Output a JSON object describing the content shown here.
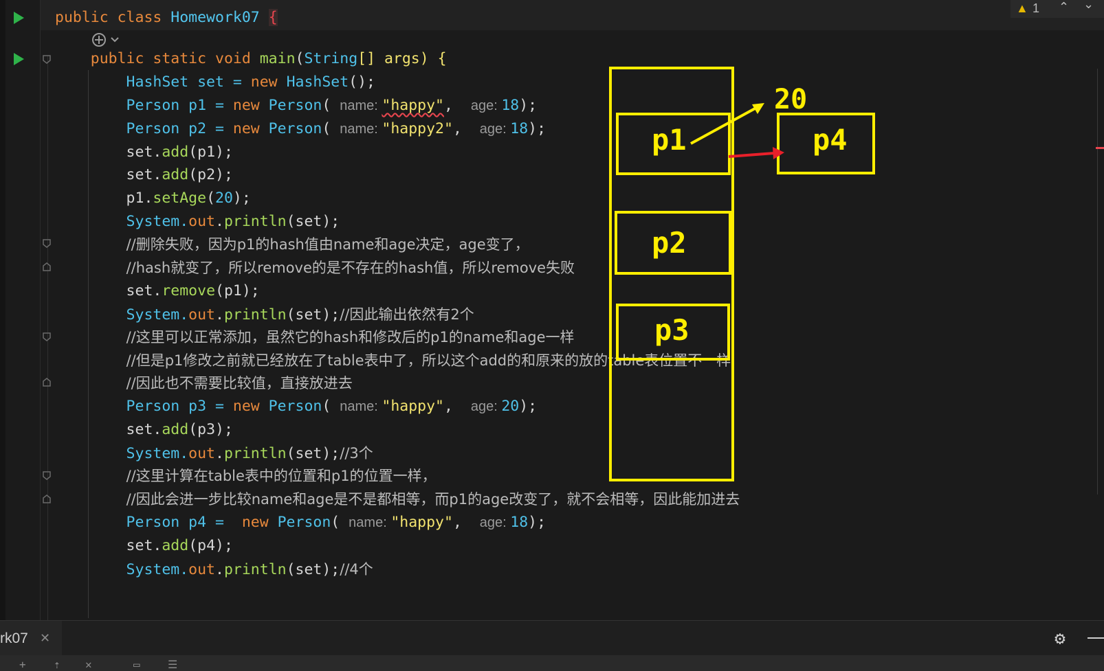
{
  "editor": {
    "lines": [
      [
        {
          "t": "public class ",
          "c": "kw"
        },
        {
          "t": "Homework07",
          "c": "fn"
        },
        {
          "t": " ",
          "c": "pn"
        },
        {
          "t": "{",
          "c": "hi-brace"
        }
      ],
      [
        {
          "t": "    public static ",
          "c": "kw"
        },
        {
          "t": "void ",
          "c": "kw"
        },
        {
          "t": "main",
          "c": "mt"
        },
        {
          "t": "(",
          "c": "pn"
        },
        {
          "t": "String",
          "c": "ty"
        },
        {
          "t": "[] args) {",
          "c": "br"
        }
      ],
      [
        {
          "t": "        HashSet set = ",
          "c": "ty"
        },
        {
          "t": "new ",
          "c": "kw"
        },
        {
          "t": "HashSet",
          "c": "ty"
        },
        {
          "t": "();",
          "c": "pn"
        }
      ],
      [
        {
          "t": "        Person p1 = ",
          "c": "ty"
        },
        {
          "t": "new ",
          "c": "kw"
        },
        {
          "t": "Person",
          "c": "ty"
        },
        {
          "t": "( ",
          "c": "pn"
        },
        {
          "t": "name: ",
          "c": "hint"
        },
        {
          "t": "\"happy\"",
          "c": "st squig"
        },
        {
          "t": ",  ",
          "c": "pn"
        },
        {
          "t": "age: ",
          "c": "hint"
        },
        {
          "t": "18",
          "c": "nm"
        },
        {
          "t": ");",
          "c": "pn"
        }
      ],
      [
        {
          "t": "        Person p2 = ",
          "c": "ty"
        },
        {
          "t": "new ",
          "c": "kw"
        },
        {
          "t": "Person",
          "c": "ty"
        },
        {
          "t": "( ",
          "c": "pn"
        },
        {
          "t": "name: ",
          "c": "hint"
        },
        {
          "t": "\"happy2\"",
          "c": "st"
        },
        {
          "t": ",  ",
          "c": "pn"
        },
        {
          "t": "age: ",
          "c": "hint"
        },
        {
          "t": "18",
          "c": "nm"
        },
        {
          "t": ");",
          "c": "pn"
        }
      ],
      [
        {
          "t": "        set.",
          "c": "pn"
        },
        {
          "t": "add",
          "c": "mt"
        },
        {
          "t": "(p1);",
          "c": "pn"
        }
      ],
      [
        {
          "t": "        set.",
          "c": "pn"
        },
        {
          "t": "add",
          "c": "mt"
        },
        {
          "t": "(p2);",
          "c": "pn"
        }
      ],
      [
        {
          "t": "        p1.",
          "c": "pn"
        },
        {
          "t": "setAge",
          "c": "mt"
        },
        {
          "t": "(",
          "c": "pn"
        },
        {
          "t": "20",
          "c": "nm"
        },
        {
          "t": ");",
          "c": "pn"
        }
      ],
      [
        {
          "t": "        System.",
          "c": "ty"
        },
        {
          "t": "out",
          "c": "kw"
        },
        {
          "t": ".",
          "c": "pn"
        },
        {
          "t": "println",
          "c": "mt"
        },
        {
          "t": "(set);",
          "c": "pn"
        }
      ],
      [
        {
          "t": "        ",
          "c": "pn"
        },
        {
          "t": "//删除失败，因为p1的hash值由name和age决定，age变了，",
          "c": "cm"
        }
      ],
      [
        {
          "t": "        ",
          "c": "pn"
        },
        {
          "t": "//hash就变了，所以remove的是不存在的hash值，所以remove失败",
          "c": "cm"
        }
      ],
      [
        {
          "t": "        set.",
          "c": "pn"
        },
        {
          "t": "remove",
          "c": "mt"
        },
        {
          "t": "(p1);",
          "c": "pn"
        }
      ],
      [
        {
          "t": "        System.",
          "c": "ty"
        },
        {
          "t": "out",
          "c": "kw"
        },
        {
          "t": ".",
          "c": "pn"
        },
        {
          "t": "println",
          "c": "mt"
        },
        {
          "t": "(set);",
          "c": "pn"
        },
        {
          "t": "//因此输出依然有2个",
          "c": "cm"
        }
      ],
      [
        {
          "t": "        ",
          "c": "pn"
        },
        {
          "t": "//这里可以正常添加，虽然它的hash和修改后的p1的name和age一样",
          "c": "cm"
        }
      ],
      [
        {
          "t": "        ",
          "c": "pn"
        },
        {
          "t": "//但是p1修改之前就已经放在了table表中了，所以这个add的和原来的放的table表位置不一样",
          "c": "cm"
        }
      ],
      [
        {
          "t": "        ",
          "c": "pn"
        },
        {
          "t": "//因此也不需要比较值，直接放进去",
          "c": "cm"
        }
      ],
      [
        {
          "t": "        Person p3 = ",
          "c": "ty"
        },
        {
          "t": "new ",
          "c": "kw"
        },
        {
          "t": "Person",
          "c": "ty"
        },
        {
          "t": "( ",
          "c": "pn"
        },
        {
          "t": "name: ",
          "c": "hint"
        },
        {
          "t": "\"happy\"",
          "c": "st"
        },
        {
          "t": ",  ",
          "c": "pn"
        },
        {
          "t": "age: ",
          "c": "hint"
        },
        {
          "t": "20",
          "c": "nm"
        },
        {
          "t": ");",
          "c": "pn"
        }
      ],
      [
        {
          "t": "        set.",
          "c": "pn"
        },
        {
          "t": "add",
          "c": "mt"
        },
        {
          "t": "(p3);",
          "c": "pn"
        }
      ],
      [
        {
          "t": "        System.",
          "c": "ty"
        },
        {
          "t": "out",
          "c": "kw"
        },
        {
          "t": ".",
          "c": "pn"
        },
        {
          "t": "println",
          "c": "mt"
        },
        {
          "t": "(set);",
          "c": "pn"
        },
        {
          "t": "//3个",
          "c": "cm"
        }
      ],
      [
        {
          "t": "        ",
          "c": "pn"
        },
        {
          "t": "//这里计算在table表中的位置和p1的位置一样，",
          "c": "cm"
        }
      ],
      [
        {
          "t": "        ",
          "c": "pn"
        },
        {
          "t": "//因此会进一步比较name和age是不是都相等，而p1的age改变了，就不会相等，因此能加进去",
          "c": "cm"
        }
      ],
      [
        {
          "t": "        Person p4 =  ",
          "c": "ty"
        },
        {
          "t": "new ",
          "c": "kw"
        },
        {
          "t": "Person",
          "c": "ty"
        },
        {
          "t": "( ",
          "c": "pn"
        },
        {
          "t": "name: ",
          "c": "hint"
        },
        {
          "t": "\"happy\"",
          "c": "st"
        },
        {
          "t": ",  ",
          "c": "pn"
        },
        {
          "t": "age: ",
          "c": "hint"
        },
        {
          "t": "18",
          "c": "nm"
        },
        {
          "t": ");",
          "c": "pn"
        }
      ],
      [
        {
          "t": "        set.",
          "c": "pn"
        },
        {
          "t": "add",
          "c": "mt"
        },
        {
          "t": "(p4);",
          "c": "pn"
        }
      ],
      [
        {
          "t": "        System.",
          "c": "ty"
        },
        {
          "t": "out",
          "c": "kw"
        },
        {
          "t": ".",
          "c": "pn"
        },
        {
          "t": "println",
          "c": "mt"
        },
        {
          "t": "(set);",
          "c": "pn"
        },
        {
          "t": "//4个",
          "c": "cm"
        }
      ]
    ]
  },
  "overlay": {
    "labels": {
      "p1": "p1",
      "p2": "p2",
      "p3": "p3",
      "p4": "p4",
      "age": "20"
    },
    "colors": {
      "drawing": "#ffee00",
      "arrow": "#e8202a"
    }
  },
  "warnings": {
    "count": "1"
  },
  "bottom": {
    "tab_label": "rk07",
    "tab_close": "✕",
    "gear": "⚙"
  },
  "toolbar": {
    "icons": [
      "+",
      "⇡",
      "✕",
      "▭",
      "☰"
    ]
  },
  "icons": {
    "run": "run-icon",
    "fold": "fold-icon",
    "ai": "ai-assistant-icon"
  }
}
